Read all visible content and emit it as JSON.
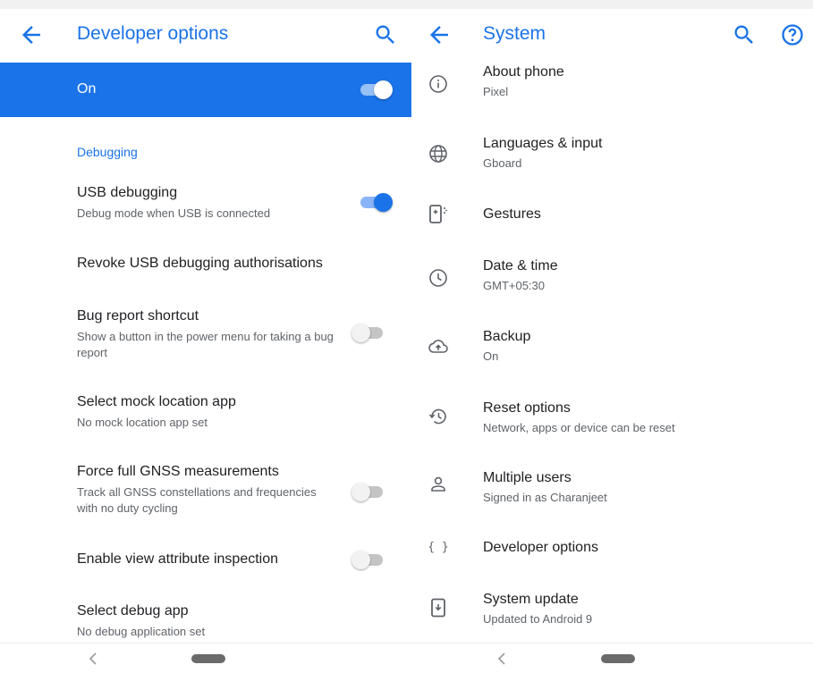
{
  "left_screen": {
    "title": "Developer options",
    "master_switch": {
      "label": "On",
      "state": "on"
    },
    "section_title": "Debugging",
    "items": [
      {
        "title": "USB debugging",
        "summary": "Debug mode when USB is connected",
        "switch": "on"
      },
      {
        "title": "Revoke USB debugging authorisations"
      },
      {
        "title": "Bug report shortcut",
        "summary": "Show a button in the power menu for taking a bug report",
        "switch": "off"
      },
      {
        "title": "Select mock location app",
        "summary": "No mock location app set"
      },
      {
        "title": "Force full GNSS measurements",
        "summary": "Track all GNSS constellations and frequencies with no duty cycling",
        "switch": "off"
      },
      {
        "title": "Enable view attribute inspection",
        "switch": "off"
      },
      {
        "title": "Select debug app",
        "summary": "No debug application set"
      }
    ]
  },
  "right_screen": {
    "title": "System",
    "items": [
      {
        "title": "About phone",
        "summary": "Pixel",
        "icon": "info-icon"
      },
      {
        "title": "Languages & input",
        "summary": "Gboard",
        "icon": "globe-icon"
      },
      {
        "title": "Gestures",
        "icon": "gestures-icon"
      },
      {
        "title": "Date & time",
        "summary": "GMT+05:30",
        "icon": "clock-icon"
      },
      {
        "title": "Backup",
        "summary": "On",
        "icon": "cloud-upload-icon"
      },
      {
        "title": "Reset options",
        "summary": "Network, apps or device can be reset",
        "icon": "restore-icon"
      },
      {
        "title": "Multiple users",
        "summary": "Signed in as Charanjeet",
        "icon": "person-icon"
      },
      {
        "title": "Developer options",
        "icon": "braces-icon"
      },
      {
        "title": "System update",
        "summary": "Updated to Android 9",
        "icon": "system-update-icon"
      }
    ]
  },
  "nav": {
    "back_glyph": "<"
  },
  "colors": {
    "accent": "#1a73e8",
    "text_primary": "#202124",
    "text_secondary": "#5f6368"
  }
}
